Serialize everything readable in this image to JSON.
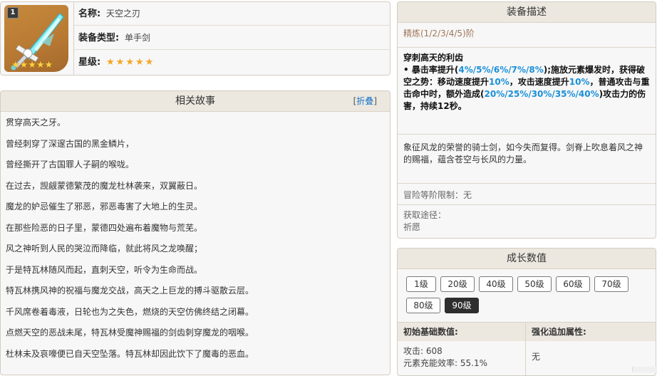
{
  "weapon": {
    "refine_badge": "1",
    "thumb_stars": "★★★★★",
    "labels": {
      "name": "名称:",
      "type": "装备类型:",
      "rarity": "星级:"
    },
    "name": "天空之刃",
    "type": "单手剑",
    "rarity_stars": "★★★★★"
  },
  "story": {
    "title": "相关故事",
    "fold": {
      "open": "[",
      "label": "折叠",
      "close": "]"
    },
    "lines": [
      "贯穿高天之牙。",
      "曾经刺穿了深邃古国的黑金鳞片，",
      "曾经撕开了古国罪人子嗣的喉咙。",
      "在过去，觊觎蒙德繁茂的魔龙杜林袭来，双翼蔽日。",
      "魔龙的妒忌催生了邪恶，邪恶毒害了大地上的生灵。",
      "在那些险恶的日子里，蒙德四处遍布着魔物与荒芜。",
      "风之神听到人民的哭泣而降临，就此将风之龙唤醒；",
      "于是特瓦林随风而起，直刺天空，听令为生命而战。",
      "特瓦林携风神的祝福与魔龙交战，高天之上巨龙的搏斗驱散云层。",
      "千风席卷着毒液，日轮也为之失色，燃烧的天空仿佛终结之闭幕。",
      "点燃天空的恶战未尾，特瓦林受魔神赐福的剑齿刺穿魔龙的咽喉。",
      "杜林未及哀嚎便已自天空坠落。特瓦林却因此饮下了魔毒的恶血。"
    ]
  },
  "description": {
    "title": "装备描述",
    "refine": "精炼(1/2/3/4/5)阶",
    "effect": {
      "heading": "穿刺高天的利齿",
      "p1": "• 暴击率提升(",
      "v1": "4%/5%/6%/7%/8%",
      "p2": ");施放元素爆发时，获得破空之势：移动速度提升",
      "v2": "10%",
      "p3": "，攻击速度提升",
      "v3": "10%",
      "p4": "，普通攻击与重击命中时，额外造成(",
      "v4": "20%/25%/30%/35%/40%",
      "p5": ")攻击力的伤害，持续12秒。"
    },
    "lore": "象征风龙的荣誉的骑士剑，如今失而复得。剑脊上吹息着风之神的赐福，蕴含苍空与长风的力量。",
    "level_limit": "冒险等阶限制：无",
    "source_label": "获取途径：",
    "source_value": "祈愿"
  },
  "growth": {
    "title": "成长数值",
    "levels": [
      "1级",
      "20级",
      "40级",
      "50级",
      "60级",
      "70级",
      "80级",
      "90级"
    ],
    "active_level": "90级",
    "base_head": "初始基础数值:",
    "bonus_head": "强化追加属性:",
    "atk": "攻击: 608",
    "energy": "元素充能效率: 55.1%",
    "bonus_value": "无"
  }
}
